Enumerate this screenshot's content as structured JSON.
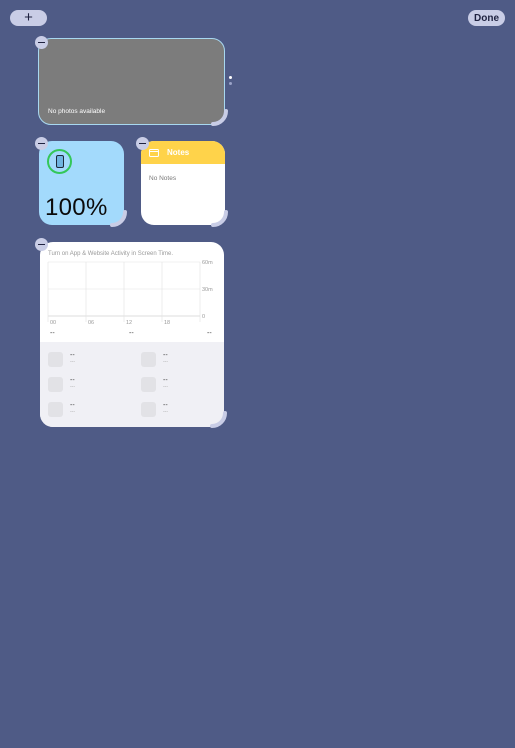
{
  "toolbar": {
    "add_label": "+",
    "done_label": "Done"
  },
  "photos_widget": {
    "label": "No photos available"
  },
  "battery_widget": {
    "percent": "100%"
  },
  "notes_widget": {
    "title": "Notes",
    "body": "No Notes"
  },
  "screen_time_widget": {
    "message": "Turn on App & Website Activity in Screen Time.",
    "chart_data": {
      "type": "bar",
      "x_ticks": [
        "00",
        "06",
        "12",
        "18"
      ],
      "y_ticks": [
        "60m",
        "30m",
        "0"
      ],
      "values": [],
      "grid": true
    },
    "summary": [
      "--",
      "--",
      "--"
    ],
    "apps": [
      {
        "name": "--",
        "time": "---"
      },
      {
        "name": "--",
        "time": "---"
      },
      {
        "name": "--",
        "time": "---"
      },
      {
        "name": "--",
        "time": "---"
      },
      {
        "name": "--",
        "time": "---"
      },
      {
        "name": "--",
        "time": "---"
      }
    ]
  },
  "colors": {
    "background": "#4f5b86",
    "accent_green": "#34c759",
    "notes_yellow": "#ffd34a",
    "battery_blue": "#a3dafc"
  },
  "icons": [
    "minus-icon",
    "resize-handle-icon",
    "ipad-icon",
    "folder-icon"
  ]
}
